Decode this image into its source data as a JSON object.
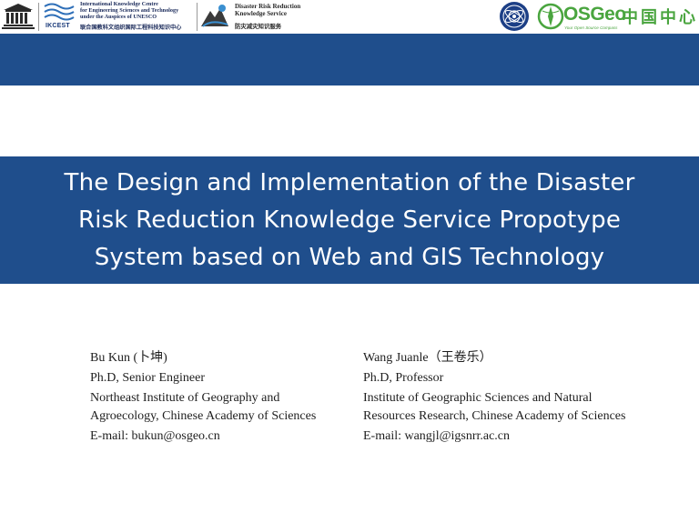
{
  "header": {
    "unesco_logo": "unesco-logo",
    "iknest": {
      "tag": "IKCEST",
      "text_lines": [
        "International Knowledge Centre",
        "for Engineering Sciences and Technology",
        "under the Auspices of UNESCO"
      ],
      "cn": "联合国教科文组织国际工程科技知识中心"
    },
    "drr": {
      "text_lines": [
        "Disaster Risk Reduction",
        "Knowledge Service"
      ],
      "cn": "防灾减灾知识服务"
    },
    "seal_logo": "cas-seal-logo",
    "osgeo": {
      "name": "OSGeo",
      "cn": "中国中心",
      "tagline": "Your Open Source Compass"
    }
  },
  "title_lines": [
    "The Design and Implementation of the Disaster",
    "Risk Reduction Knowledge Service Propotype",
    "System based on Web and GIS Technology"
  ],
  "authors": [
    {
      "name": "Bu Kun (卜坤)",
      "degree": "Ph.D, Senior Engineer",
      "affiliation_lines": [
        "Northeast Institute of Geography and",
        "Agroecology, Chinese Academy of Sciences"
      ],
      "email": "E-mail: bukun@osgeo.cn"
    },
    {
      "name": "Wang Juanle（王卷乐）",
      "degree": "Ph.D, Professor",
      "affiliation_lines": [
        "Institute of Geographic Sciences and Natural",
        "Resources Research, Chinese Academy of Sciences"
      ],
      "email": "E-mail: wangjl@igsnrr.ac.cn"
    }
  ],
  "colors": {
    "band_blue": "#1f4e8c",
    "osgeo_green": "#4aa53f"
  }
}
